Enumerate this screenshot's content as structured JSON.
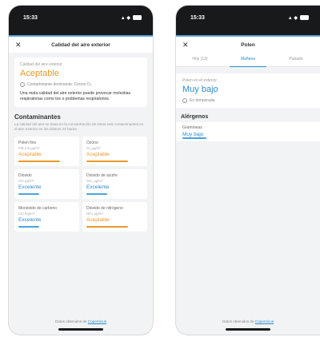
{
  "screenA": {
    "status_time": "15:33",
    "status_icons": "▲ ◆",
    "nav_title": "Calidad del aire exterior",
    "summary": {
      "label": "Calidad del aire exterior",
      "value": "Aceptable",
      "info_text": "Contaminante dominante: Ozono O₃",
      "description": "Una mala calidad del aire exterior puede provocar molestias respiratorias como tos o problemas respiratorios."
    },
    "pollutants_title": "Contaminantes",
    "pollutants_subtitle": "La calidad del aire se basa en la concentración de estos seis contaminantes en el aire exterior en los últimos 24 horas.",
    "pollutants": [
      {
        "name": "Polen fino",
        "sub": "PM 2,5 μg/m³",
        "value": "Aceptable",
        "tone": "orange"
      },
      {
        "name": "Ozono",
        "sub": "O₃ μg/m³",
        "value": "Aceptable",
        "tone": "orange"
      },
      {
        "name": "Dióxido",
        "sub": "CO μg/m³",
        "value": "Excelente",
        "tone": "blue"
      },
      {
        "name": "Dióxido de azufre",
        "sub": "SO₂ μg/m³",
        "value": "Excelente",
        "tone": "blue"
      },
      {
        "name": "Monóxido de carbono",
        "sub": "CO mg/m³",
        "value": "Excelente",
        "tone": "blue"
      },
      {
        "name": "Dióxido de nitrógeno",
        "sub": "NO₂ μg/m³",
        "value": "Aceptable",
        "tone": "orange"
      }
    ],
    "footer_text": "Datos obtenidos de",
    "footer_link": "Copernicus"
  },
  "screenB": {
    "status_time": "15:33",
    "status_icons": "▲ ◆",
    "nav_title": "Polen",
    "tabs": [
      {
        "label": "Hoy (13)",
        "active": false
      },
      {
        "label": "Mañana",
        "active": true
      },
      {
        "label": "Pasado",
        "active": false
      }
    ],
    "summary": {
      "label": "Polen en el exterior",
      "value": "Muy bajo",
      "info_text": "En temporada"
    },
    "allergens_title": "Alérgenos",
    "allergen": {
      "name": "Gramíneas",
      "value": "Muy bajo"
    },
    "footer_text": "Datos obtenidos de",
    "footer_link": "Copernicus"
  },
  "colors": {
    "accent_orange": "#e79a2b",
    "accent_blue": "#2e8bc9",
    "background": "#f1f3f4"
  }
}
